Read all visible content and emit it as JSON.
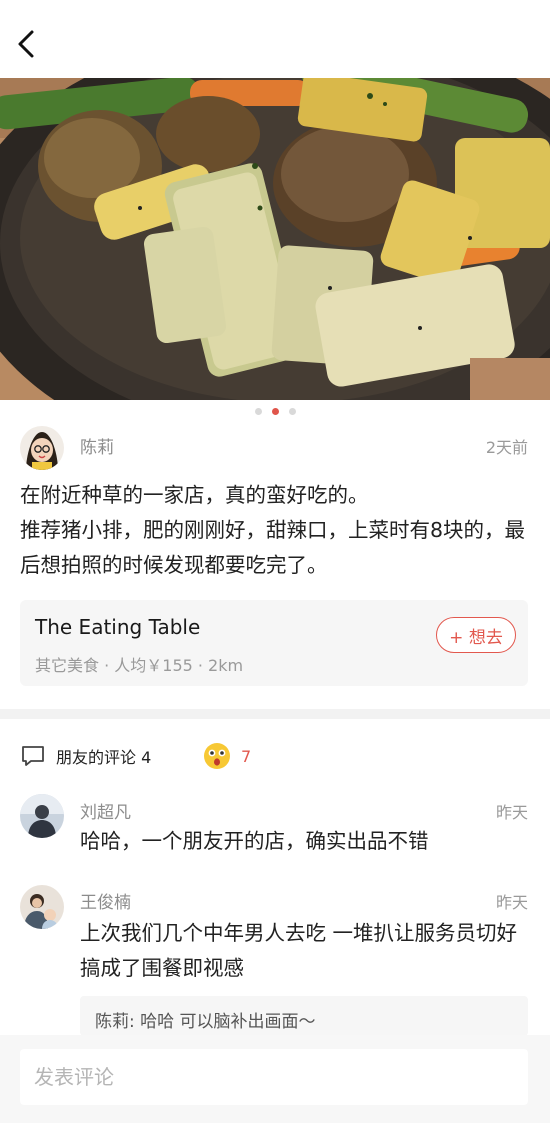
{
  "header": {
    "back_icon": "chevron-left-icon"
  },
  "hero": {
    "photo_index": 2,
    "photo_count": 3
  },
  "post": {
    "author": "陈莉",
    "time": "2天前",
    "body_lines": [
      "在附近种草的一家店，真的蛮好吃的。",
      "推荐猪小排，肥的刚刚好，甜辣口，上菜时有8块的，最后想拍照的时候发现都要吃完了。"
    ]
  },
  "shop": {
    "name": "The Eating Table",
    "meta": "其它美食 · 人均￥155 · 2km",
    "want_label": "+ 想去"
  },
  "comments_section": {
    "title": "朋友的评论 4",
    "comment_icon": "speech-bubble-icon",
    "like_icon": "wow-face-emoji-icon",
    "like_count": "7"
  },
  "comments": [
    {
      "author": "刘超凡",
      "time": "昨天",
      "text": "哈哈，一个朋友开的店，确实出品不错"
    },
    {
      "author": "王俊楠",
      "time": "昨天",
      "text": "上次我们几个中年男人去吃 一堆扒让服务员切好 搞成了围餐即视感"
    }
  ],
  "reply": {
    "author": "陈莉",
    "text": "陈莉: 哈哈 可以脑补出画面～"
  },
  "composer": {
    "placeholder": "发表评论"
  },
  "colors": {
    "accent": "#e2584e",
    "meta_gray": "#9a9a9a",
    "card_bg": "#f6f6f6"
  }
}
